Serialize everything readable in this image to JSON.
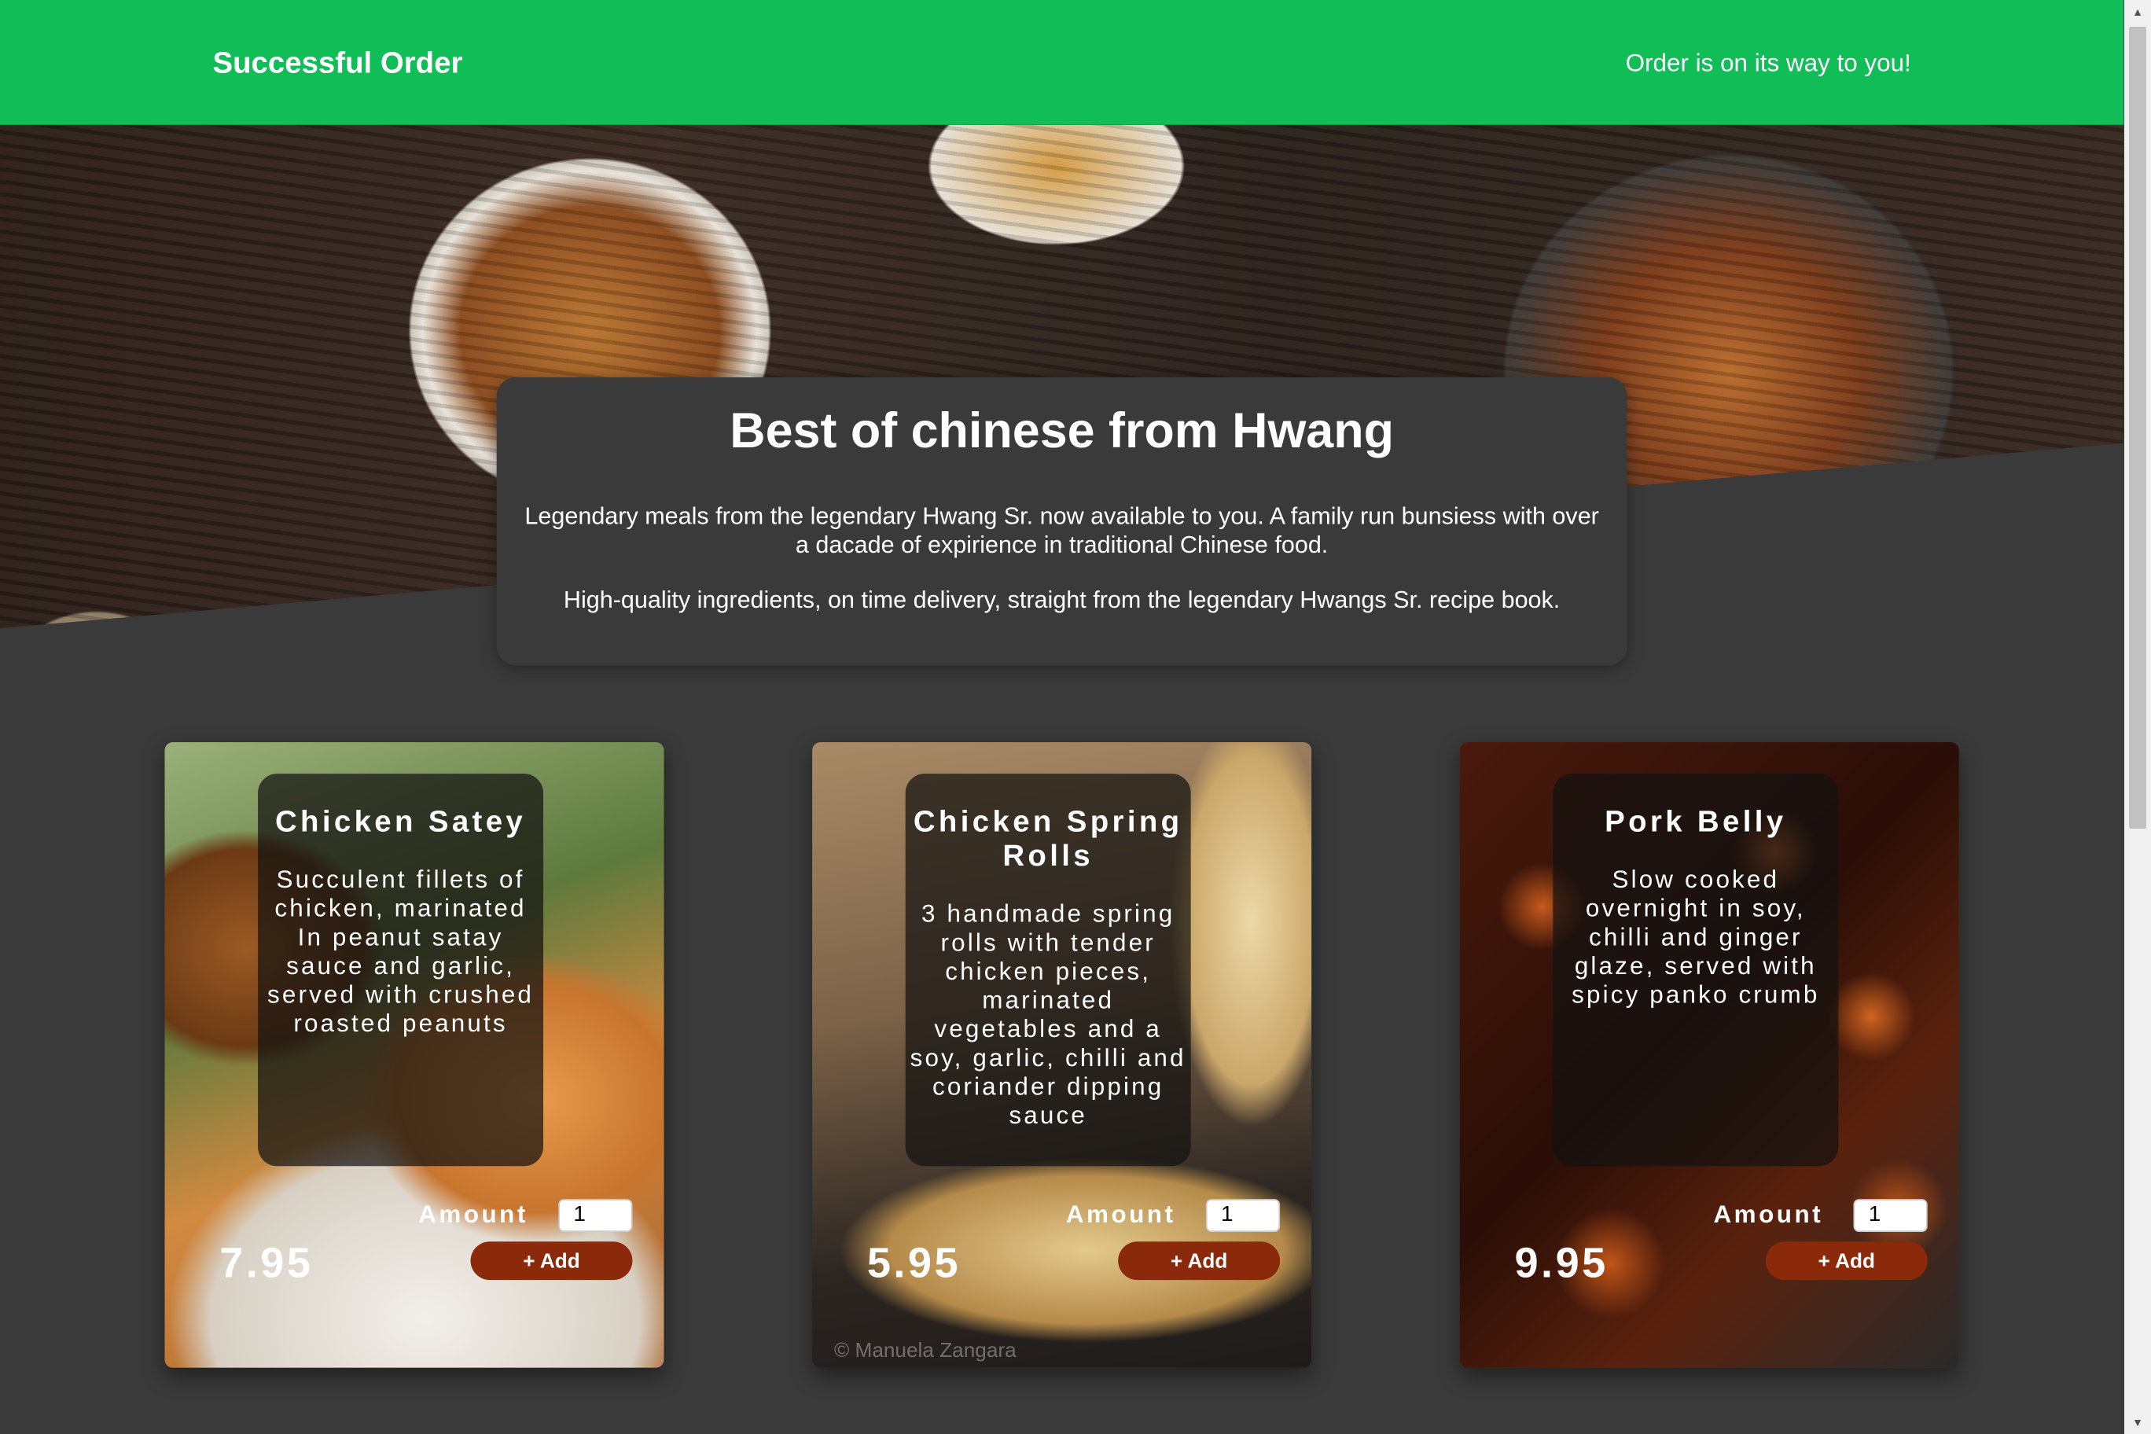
{
  "header": {
    "brand": "Successful Order",
    "status": "Order is on its way to you!"
  },
  "intro": {
    "title": "Best of chinese from Hwang",
    "paragraph1": "Legendary meals from the legendary Hwang Sr. now available to you. A family run bunsiess with over a dacade of expirience in traditional Chinese food.",
    "paragraph2": "High-quality ingredients, on time delivery, straight from the legendary Hwangs Sr. recipe book."
  },
  "meals": [
    {
      "name": "Chicken Satey",
      "description": "Succulent fillets of chicken, marinated In peanut satay sauce and garlic, served with crushed roasted peanuts",
      "amount_label": "Amount",
      "amount_value": "1",
      "price": "7.95",
      "add_label": "+ Add"
    },
    {
      "name": "Chicken Spring Rolls",
      "description": "3 handmade spring rolls with tender chicken pieces, marinated vegetables and a soy, garlic, chilli and coriander dipping sauce",
      "amount_label": "Amount",
      "amount_value": "1",
      "price": "5.95",
      "add_label": "+ Add",
      "watermark": "© Manuela Zangara"
    },
    {
      "name": "Pork Belly",
      "description": "Slow cooked overnight in soy, chilli and ginger glaze, served with spicy panko crumb",
      "amount_label": "Amount",
      "amount_value": "1",
      "price": "9.95",
      "add_label": "+ Add"
    }
  ],
  "colors": {
    "header_bg": "#10bd57",
    "page_bg": "#3a3a3a",
    "add_button": "#8a2a0a"
  }
}
